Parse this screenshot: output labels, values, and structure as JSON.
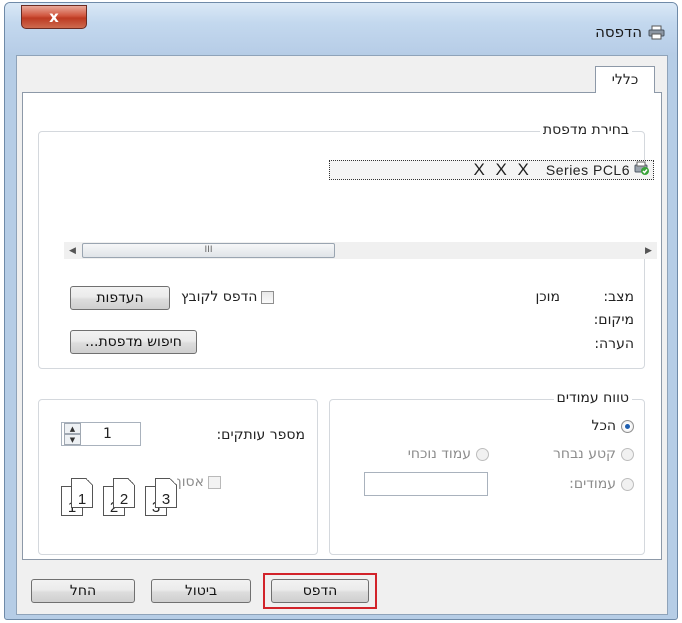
{
  "window": {
    "title": "הדפסה",
    "close_label": "x"
  },
  "tabs": [
    {
      "label": "כללי"
    }
  ],
  "select_printer": {
    "label": "בחירת מדפסת",
    "printers": [
      {
        "name": "Series PCL6",
        "prefix": "X X X"
      }
    ],
    "scrollbar_thumb": "III"
  },
  "status": {
    "state_label": "מצב:",
    "state_value": "מוכן",
    "location_label": "מיקום:",
    "comment_label": "הערה:",
    "print_to_file_label": "הדפס לקובץ",
    "preferences_button": "העדפות",
    "find_printer_button": "חיפוש מדפסת..."
  },
  "page_range": {
    "label": "טווח עמודים",
    "options": [
      {
        "label": "הכל",
        "checked": true,
        "disabled": false
      },
      {
        "label": "קטע נבחר",
        "checked": false,
        "disabled": true
      },
      {
        "label": "עמוד נוכחי",
        "checked": false,
        "disabled": true
      },
      {
        "label": "עמודים:",
        "checked": false,
        "disabled": true
      }
    ]
  },
  "copies": {
    "label": "מספר עותקים:",
    "value": "1",
    "collate_label": "אסוף",
    "collate_checked": false,
    "collate_disabled": true,
    "pages": [
      "1",
      "1",
      "2",
      "2",
      "3",
      "3"
    ]
  },
  "footer": {
    "print_button": "הדפס",
    "cancel_button": "ביטול",
    "apply_button": "החל",
    "highlight_color": "#d2232a"
  }
}
